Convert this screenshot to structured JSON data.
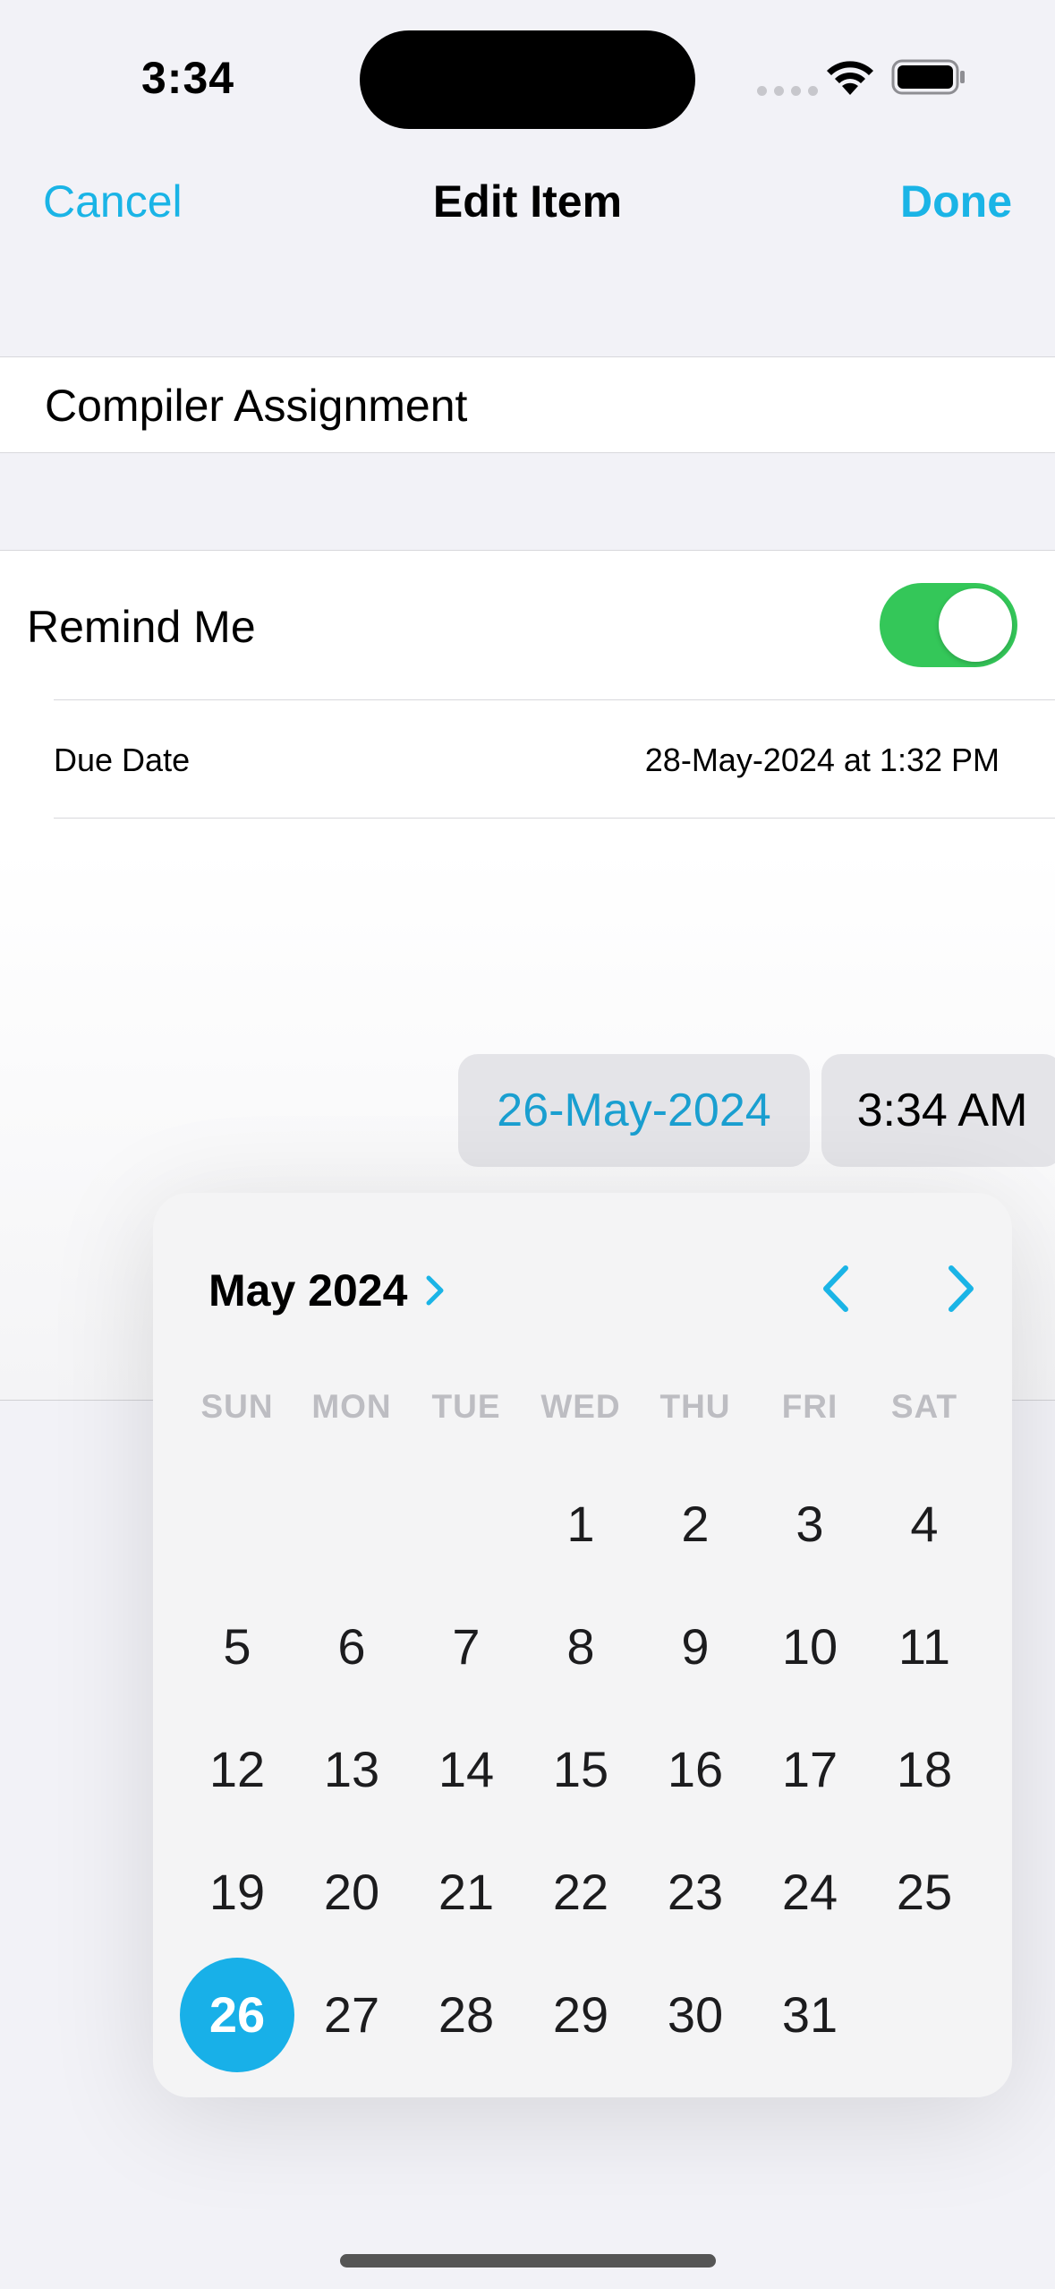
{
  "status_bar": {
    "time": "3:34"
  },
  "nav": {
    "cancel": "Cancel",
    "title": "Edit Item",
    "done": "Done"
  },
  "item": {
    "title": "Compiler Assignment"
  },
  "reminder": {
    "label": "Remind Me",
    "enabled": true,
    "due_label": "Due Date",
    "due_value": "28-May-2024 at 1:32 PM"
  },
  "picker": {
    "date": "26-May-2024",
    "time": "3:34 AM",
    "month_title": "May 2024",
    "weekdays": [
      "SUN",
      "MON",
      "TUE",
      "WED",
      "THU",
      "FRI",
      "SAT"
    ],
    "first_weekday_index": 3,
    "days_in_month": 31,
    "selected_day": 26
  },
  "colors": {
    "accent": "#1ab4e6",
    "toggle_on": "#34c759"
  },
  "icons": [
    "wifi-icon",
    "battery-icon",
    "chevron-right-icon",
    "chevron-left-icon"
  ]
}
